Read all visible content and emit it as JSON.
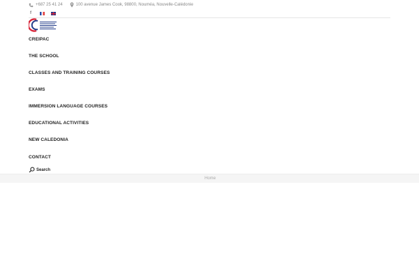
{
  "header": {
    "phone": "+687 25 41 24",
    "address": "100 avenue James Cook, 98800, Nouméa, Nouvelle-Calédonie",
    "social": {
      "facebook_icon": "facebook-icon"
    },
    "languages": [
      {
        "code": "fr",
        "icon": "flag-france-icon"
      },
      {
        "code": "en",
        "icon": "flag-uk-icon"
      }
    ]
  },
  "logo": {
    "icon": "creipac-logo",
    "colors": {
      "red": "#d8273a",
      "blue": "#233c8a"
    }
  },
  "nav": {
    "items": [
      {
        "label": "CREIPAC"
      },
      {
        "label": "THE SCHOOL"
      },
      {
        "label": "CLASSES AND TRAINING COURSES"
      },
      {
        "label": "EXAMS"
      },
      {
        "label": "IMMERSION LANGUAGE COURSES"
      },
      {
        "label": "EDUCATIONAL ACTIVITIES"
      },
      {
        "label": "NEW CALEDONIA"
      },
      {
        "label": "CONTACT"
      }
    ],
    "search_label": "Search"
  },
  "breadcrumb": {
    "home": "Home"
  }
}
